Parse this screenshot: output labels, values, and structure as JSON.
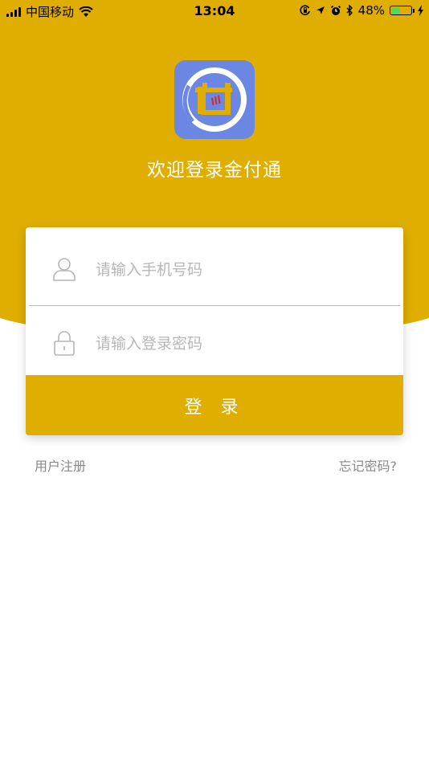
{
  "status_bar": {
    "carrier": "中国移动",
    "time": "13:04",
    "battery_percent": "48%",
    "battery_level": 0.48,
    "icons": [
      "signal-icon",
      "wifi-icon",
      "orientation-lock-icon",
      "location-icon",
      "alarm-icon",
      "bluetooth-icon",
      "battery-icon",
      "charging-icon"
    ]
  },
  "header": {
    "logo_icon": "jinfutong-logo-icon",
    "welcome_title": "欢迎登录金付通"
  },
  "form": {
    "phone_placeholder": "请输入手机号码",
    "phone_icon": "user-icon",
    "password_placeholder": "请输入登录密码",
    "password_icon": "lock-icon",
    "login_label": "登 录"
  },
  "links": {
    "register_label": "用户注册",
    "forgot_label": "忘记密码?"
  },
  "colors": {
    "accent": "#e0ae00",
    "logo_bg": "#6b87e3",
    "battery_green": "#4cd964"
  }
}
